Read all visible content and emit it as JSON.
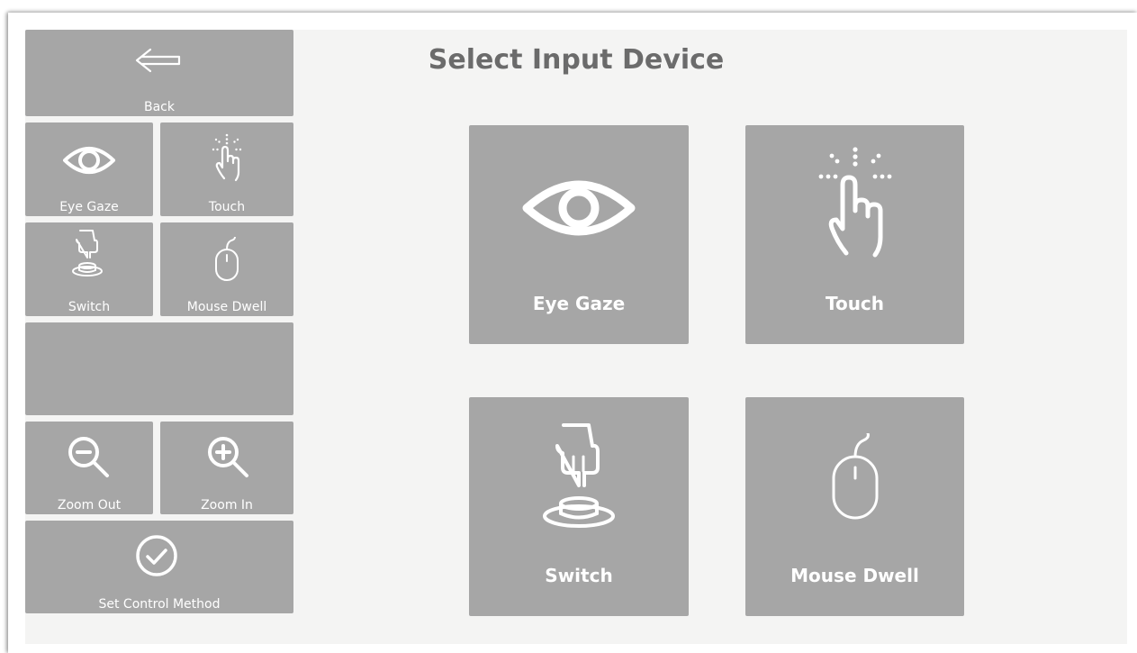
{
  "title": "Select Input Device",
  "sidebar": {
    "back": {
      "label": "Back",
      "icon": "arrow-left-icon"
    },
    "eye_gaze": {
      "label": "Eye Gaze",
      "icon": "eye-icon"
    },
    "touch": {
      "label": "Touch",
      "icon": "tap-hand-icon"
    },
    "switch": {
      "label": "Switch",
      "icon": "switch-press-icon"
    },
    "mouse_dwell": {
      "label": "Mouse Dwell",
      "icon": "mouse-icon"
    },
    "zoom_out": {
      "label": "Zoom Out",
      "icon": "zoom-out-icon"
    },
    "zoom_in": {
      "label": "Zoom In",
      "icon": "zoom-in-icon"
    },
    "set_control": {
      "label": "Set Control Method",
      "icon": "checkmark-circle-icon"
    }
  },
  "devices": {
    "eye_gaze": {
      "label": "Eye Gaze",
      "icon": "eye-icon"
    },
    "touch": {
      "label": "Touch",
      "icon": "tap-hand-icon"
    },
    "switch": {
      "label": "Switch",
      "icon": "switch-press-icon"
    },
    "mouse_dwell": {
      "label": "Mouse Dwell",
      "icon": "mouse-icon"
    }
  },
  "colors": {
    "tile": "#a6a6a6",
    "background": "#f4f4f3",
    "title": "#6b6b6b",
    "icon": "#ffffff"
  }
}
